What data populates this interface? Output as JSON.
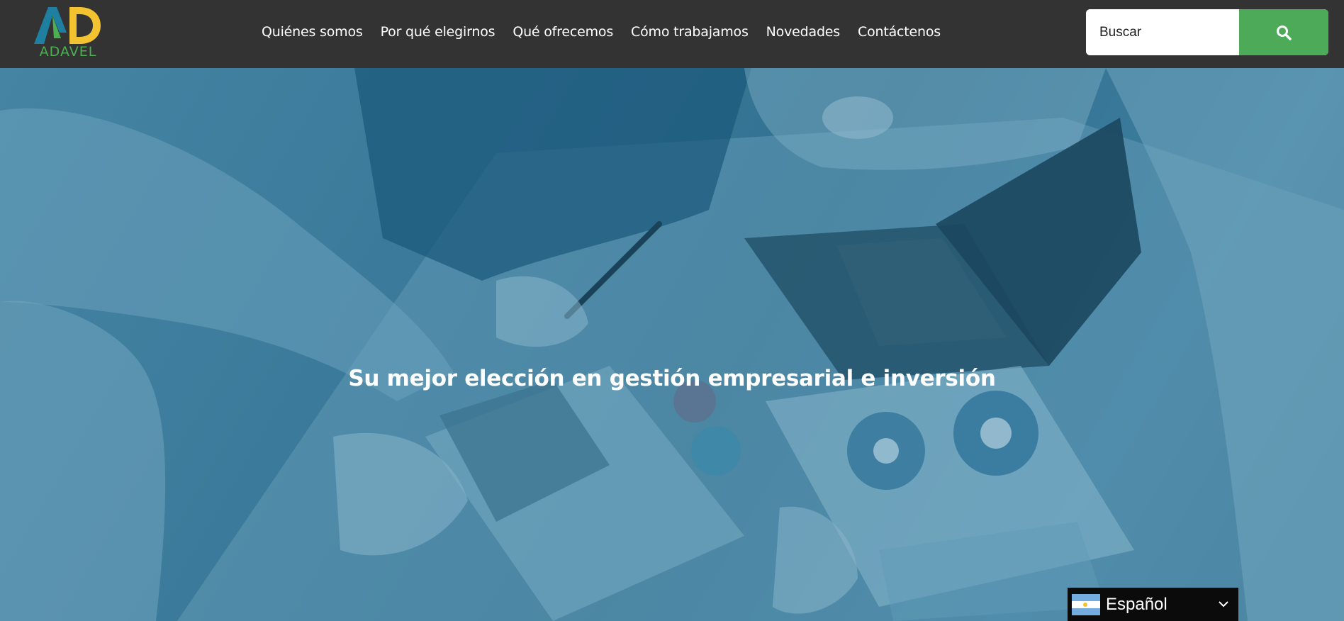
{
  "header": {
    "logo": {
      "text": "ADAVEL"
    },
    "nav": [
      {
        "label": "Quiénes somos"
      },
      {
        "label": "Por qué elegirnos"
      },
      {
        "label": "Qué ofrecemos"
      },
      {
        "label": "Cómo trabajamos"
      },
      {
        "label": "Novedades"
      },
      {
        "label": "Contáctenos"
      }
    ],
    "search": {
      "placeholder": "Buscar",
      "value": "",
      "button_icon": "search-icon"
    }
  },
  "hero": {
    "title": "Su mejor elección en gestión empresarial e inversión"
  },
  "language": {
    "label": "Español",
    "flag_icon": "argentina-flag-icon",
    "chevron_icon": "chevron-down-icon"
  },
  "colors": {
    "header_bg": "#333333",
    "accent_green": "#4caa58",
    "logo_yellow": "#f2c230",
    "logo_teal": "#1e7fa0",
    "hero_tint": "#3d7393",
    "flag_blue": "#74acdf",
    "flag_white": "#ffffff"
  }
}
